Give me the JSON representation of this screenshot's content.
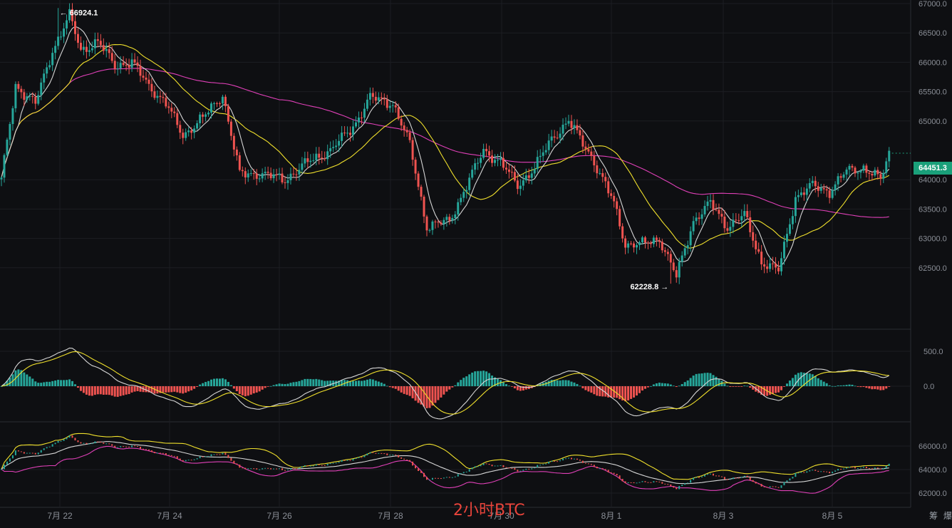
{
  "chart_data": [
    {
      "type": "candlestick",
      "panel": "price",
      "title": "2小时BTC",
      "x_ticks": [
        "7月 22",
        "7月 24",
        "7月 26",
        "7月 28",
        "7月 30",
        "8月 1",
        "8月 3",
        "8月 5"
      ],
      "y_ticks": [
        "67000.0",
        "66500.0",
        "66000.0",
        "65500.0",
        "65000.0",
        "64000.0",
        "63500.0",
        "63000.0",
        "62500.0"
      ],
      "ylim": [
        62000,
        67000
      ],
      "last_price": "64451.3",
      "annotations": {
        "high_label": "← 66924.1",
        "low_label": "62228.8 →"
      },
      "candle_colors": {
        "up": "#26a69a",
        "down": "#ef5350"
      },
      "ma_colors": [
        "#d6d6d6",
        "#f0e02c",
        "#e040b8"
      ],
      "anchors": [
        [
          0,
          64000
        ],
        [
          5,
          65600
        ],
        [
          12,
          65300
        ],
        [
          18,
          66200
        ],
        [
          24,
          66800
        ],
        [
          28,
          66200
        ],
        [
          34,
          66350
        ],
        [
          40,
          65950
        ],
        [
          46,
          66000
        ],
        [
          52,
          65600
        ],
        [
          58,
          65300
        ],
        [
          64,
          64750
        ],
        [
          72,
          65100
        ],
        [
          78,
          65450
        ],
        [
          84,
          64100
        ],
        [
          92,
          64100
        ],
        [
          100,
          64000
        ],
        [
          108,
          64300
        ],
        [
          116,
          64500
        ],
        [
          124,
          64900
        ],
        [
          130,
          65400
        ],
        [
          138,
          65300
        ],
        [
          144,
          64600
        ],
        [
          150,
          63200
        ],
        [
          158,
          63300
        ],
        [
          164,
          63900
        ],
        [
          170,
          64500
        ],
        [
          176,
          64300
        ],
        [
          182,
          63900
        ],
        [
          188,
          64200
        ],
        [
          194,
          64700
        ],
        [
          200,
          65000
        ],
        [
          208,
          64400
        ],
        [
          216,
          63600
        ],
        [
          220,
          62900
        ],
        [
          226,
          62900
        ],
        [
          232,
          63000
        ],
        [
          238,
          62350
        ],
        [
          244,
          63300
        ],
        [
          250,
          63600
        ],
        [
          256,
          63200
        ],
        [
          262,
          63400
        ],
        [
          268,
          62600
        ],
        [
          274,
          62450
        ],
        [
          280,
          63700
        ],
        [
          286,
          63900
        ],
        [
          292,
          63800
        ],
        [
          298,
          64150
        ],
        [
          304,
          64200
        ],
        [
          310,
          64000
        ],
        [
          313,
          64451
        ]
      ]
    },
    {
      "type": "macd",
      "panel": "oscillator",
      "y_ticks": [
        "500.0",
        "0.0"
      ],
      "ylim": [
        -700,
        750
      ],
      "colors": {
        "line": "#d6d6d6",
        "signal": "#f0e02c",
        "hist_up": "#26a69a",
        "hist_down": "#ef5350"
      }
    },
    {
      "type": "bands",
      "panel": "bollinger",
      "y_ticks": [
        "66000.0",
        "64000.0",
        "62000.0"
      ],
      "ylim": [
        61500,
        67600
      ],
      "colors": {
        "upper": "#f0e02c",
        "mid": "#d6d6d6",
        "lower": "#e040b8"
      }
    }
  ],
  "corner_labels": [
    "筹",
    "爆"
  ]
}
